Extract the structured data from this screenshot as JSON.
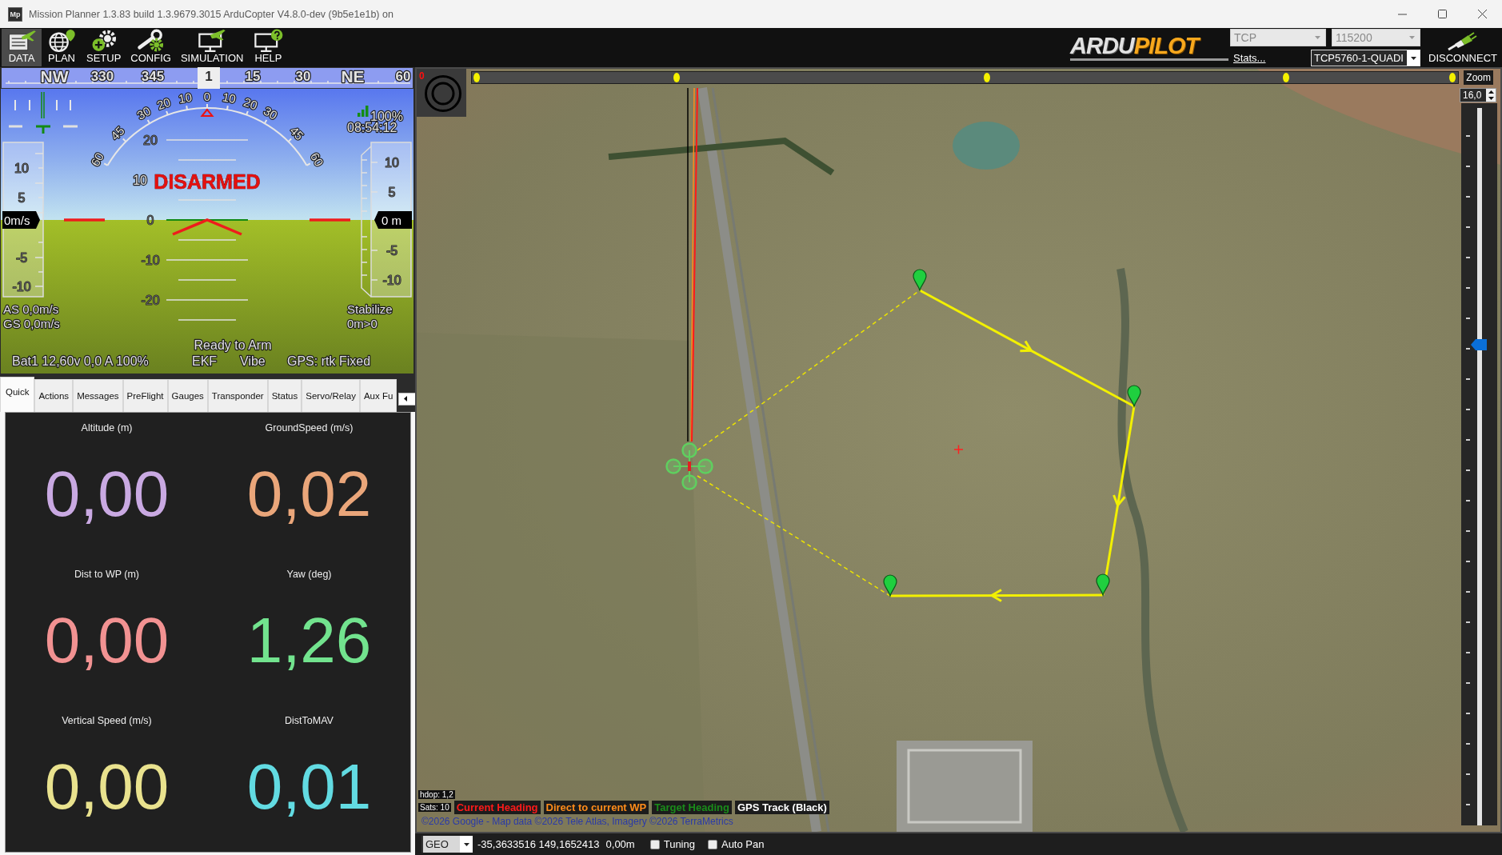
{
  "window": {
    "app_logo": "Mp",
    "title": "Mission Planner 1.3.83 build 1.3.9679.3015 ArduCopter V4.8.0-dev (9b5e1e1b) on"
  },
  "toolbar": {
    "buttons": [
      {
        "label": "DATA",
        "kind": "data",
        "selected": true
      },
      {
        "label": "PLAN",
        "kind": "plan",
        "selected": false
      },
      {
        "label": "SETUP",
        "kind": "setup",
        "selected": false
      },
      {
        "label": "CONFIG",
        "kind": "config",
        "selected": false
      },
      {
        "label": "SIMULATION",
        "kind": "simulation",
        "selected": false
      },
      {
        "label": "HELP",
        "kind": "help",
        "selected": false
      }
    ],
    "logo": [
      "ARDU",
      "PILOT"
    ],
    "protocol": "TCP",
    "baud_rate": "115200",
    "stats_link": "Stats...",
    "port": "TCP5760-1-QUADI",
    "connect_button": "DISCONNECT"
  },
  "hud": {
    "heading": [
      {
        "text": "NW",
        "kind": "cardinal",
        "selected": false
      },
      {
        "text": "330",
        "kind": "degree",
        "selected": false
      },
      {
        "text": "345",
        "kind": "degree",
        "selected": false
      },
      {
        "text": "1",
        "kind": "degree",
        "selected": true
      },
      {
        "text": "15",
        "kind": "degree",
        "selected": false
      },
      {
        "text": "30",
        "kind": "degree",
        "selected": false
      },
      {
        "text": "NE",
        "kind": "cardinal",
        "selected": false
      },
      {
        "text": "60",
        "kind": "degree",
        "selected": false
      }
    ],
    "roll_scale": [
      "60",
      "45",
      "30",
      "20",
      "10",
      "0",
      "10",
      "20",
      "30",
      "45",
      "60"
    ],
    "pitch_ladder": [
      "20",
      "10",
      "0",
      "-10",
      "-20"
    ],
    "status": "DISARMED",
    "speed_tape": {
      "labels": [
        "10",
        "5",
        "-5",
        "-10"
      ],
      "reading": "0m/s"
    },
    "altitude_tape": {
      "labels": [
        "10",
        "5",
        "-5",
        "-10"
      ],
      "reading": "0 m"
    },
    "link_quality": "100%",
    "clock": "08:54:12",
    "airspeed": "AS 0,0m/s",
    "groundspeed": "GS 0,0m/s",
    "flight_mode": "Stabilize",
    "waypoint_info": "0m>0",
    "arm_status": "Ready to Arm",
    "battery": "Bat1 12,60v 0,0 A 100%",
    "indicators": [
      "EKF",
      "Vibe"
    ],
    "gps": "GPS: rtk Fixed"
  },
  "tabs": [
    {
      "label": "Quick",
      "selected": true
    },
    {
      "label": "Actions",
      "selected": false
    },
    {
      "label": "Messages",
      "selected": false
    },
    {
      "label": "PreFlight",
      "selected": false
    },
    {
      "label": "Gauges",
      "selected": false
    },
    {
      "label": "Transponder",
      "selected": false
    },
    {
      "label": "Status",
      "selected": false
    },
    {
      "label": "Servo/Relay",
      "selected": false
    },
    {
      "label": "Aux Fu",
      "selected": false
    }
  ],
  "quick": [
    {
      "label": "Altitude (m)",
      "value": "0,00",
      "color": "#c9a9e2"
    },
    {
      "label": "GroundSpeed (m/s)",
      "value": "0,02",
      "color": "#eaa67a"
    },
    {
      "label": "Dist to WP (m)",
      "value": "0,00",
      "color": "#f29292"
    },
    {
      "label": "Yaw (deg)",
      "value": "1,26",
      "color": "#72e38e"
    },
    {
      "label": "Vertical Speed (m/s)",
      "value": "0,00",
      "color": "#e9e28e"
    },
    {
      "label": "DistToMAV",
      "value": "0,01",
      "color": "#62dbe2"
    }
  ],
  "map": {
    "counter": "0",
    "zoom_label": "Zoom",
    "zoom_value": "16,0",
    "zoom_slider": {
      "level": 0.67
    },
    "hdop": "hdop: 1,2",
    "sats": "Sats: 10",
    "legend": [
      {
        "label": "Current Heading",
        "color": "#ff1a1a"
      },
      {
        "label": "Direct to current WP",
        "color": "#ff8c1a"
      },
      {
        "label": "Target Heading",
        "color": "#1a8c1a"
      },
      {
        "label": "GPS Track (Black)",
        "color": "#ffffff"
      }
    ],
    "attribution": "©2026 Google - Map data ©2026 Tele Atlas, Imagery ©2026 TerraMetrics"
  },
  "status_bar": {
    "coord_system": "GEO",
    "coordinates": "-35,3633516 149,1652413",
    "altitude": "0,00m",
    "checkboxes": [
      {
        "label": "Tuning",
        "checked": false
      },
      {
        "label": "Auto Pan",
        "checked": false
      }
    ]
  }
}
